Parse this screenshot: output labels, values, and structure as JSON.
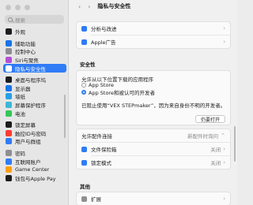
{
  "sidebar": {
    "search_placeholder": "搜索",
    "items": [
      {
        "label": "外观",
        "color": "#1d1d1f"
      },
      {
        "label": "辅助功能",
        "color": "#1a73e8"
      },
      {
        "label": "控制中心",
        "color": "#8e8e93"
      },
      {
        "label": "Siri与聚焦",
        "color": "#b34fd6"
      },
      {
        "label": "隐私与安全性",
        "color": "#2f7cf6",
        "selected": true
      },
      {
        "label": "桌面与程序坞",
        "color": "#1d1d1f"
      },
      {
        "label": "显示器",
        "color": "#1a73e8"
      },
      {
        "label": "墙纸",
        "color": "#25a0e6"
      },
      {
        "label": "屏幕保护程序",
        "color": "#3bb7d8"
      },
      {
        "label": "电池",
        "color": "#34c759"
      },
      {
        "label": "锁定屏幕",
        "color": "#1d1d1f"
      },
      {
        "label": "触控ID与密码",
        "color": "#ff3b30"
      },
      {
        "label": "用户与群组",
        "color": "#2f7cf6"
      },
      {
        "label": "密码",
        "color": "#8e8e93"
      },
      {
        "label": "互联网账户",
        "color": "#2f7cf6"
      },
      {
        "label": "Game Center",
        "color": "#ff9f0a"
      },
      {
        "label": "钱包与Apple Pay",
        "color": "#1d1d1f"
      }
    ]
  },
  "toolbar": {
    "back": "‹",
    "forward": "›",
    "title": "隐私与安全性"
  },
  "card1": {
    "rows": [
      {
        "label": "分析与改进",
        "color": "#2f7cf6"
      },
      {
        "label": "Apple广告",
        "color": "#2f7cf6"
      }
    ]
  },
  "security": {
    "title": "安全性",
    "allow_label": "允许从以下位置下载的应用程序",
    "options": [
      "App Store",
      "App Store和被认可的开发者"
    ],
    "blocked_message": "已阻止使用“VEX STEPmaker”，因为来自身份不明的开发者。",
    "open_anyway": "仍要打开"
  },
  "card2": {
    "rows": [
      {
        "label": "允许配件连接",
        "value": "新配件时询问"
      },
      {
        "label": "文件保险箱",
        "value": "关闭",
        "color": "#2f7cf6"
      },
      {
        "label": "锁定模式",
        "value": "关闭",
        "color": "#2f7cf6"
      }
    ]
  },
  "others": {
    "title": "其他",
    "rows": [
      {
        "label": "扩展",
        "color": "#8e8e93"
      }
    ]
  }
}
